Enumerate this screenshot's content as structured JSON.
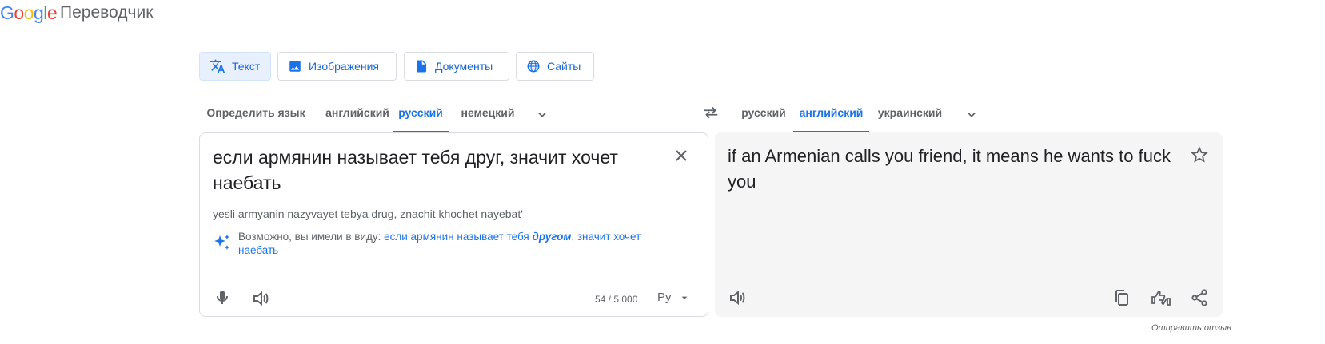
{
  "header": {
    "logo": "Google",
    "product_name": "Переводчик"
  },
  "mode_tabs": [
    {
      "label": "Текст",
      "icon": "translate-icon",
      "active": true
    },
    {
      "label": "Изображения",
      "icon": "image-icon",
      "active": false
    },
    {
      "label": "Документы",
      "icon": "document-icon",
      "active": false
    },
    {
      "label": "Сайты",
      "icon": "globe-icon",
      "active": false
    }
  ],
  "source_languages": [
    {
      "label": "Определить язык",
      "active": false
    },
    {
      "label": "английский",
      "active": false
    },
    {
      "label": "русский",
      "active": true
    },
    {
      "label": "немецкий",
      "active": false
    }
  ],
  "target_languages": [
    {
      "label": "русский",
      "active": false
    },
    {
      "label": "английский",
      "active": true
    },
    {
      "label": "украинский",
      "active": false
    }
  ],
  "source": {
    "text": " если армянин называет тебя друг, значит хочет наебать",
    "transliteration": "yesli armyanin nazyvayet tebya drug, znachit khochet nayebat'",
    "suggestion_prefix": "Возможно, вы имели в виду: ",
    "suggestion_before": "если армянин называет тебя ",
    "suggestion_bold": "другом",
    "suggestion_after": ", значит хочет наебать",
    "char_count": "54 / 5 000",
    "ime_label": "Ру"
  },
  "target": {
    "text": "if an Armenian calls you friend, it means he wants to fuck you"
  },
  "feedback_label": "Отправить отзыв",
  "colors": {
    "accent": "#1a73e8",
    "border": "#dadce0",
    "target_bg": "#f5f5f5",
    "muted_text": "#5f6368"
  }
}
